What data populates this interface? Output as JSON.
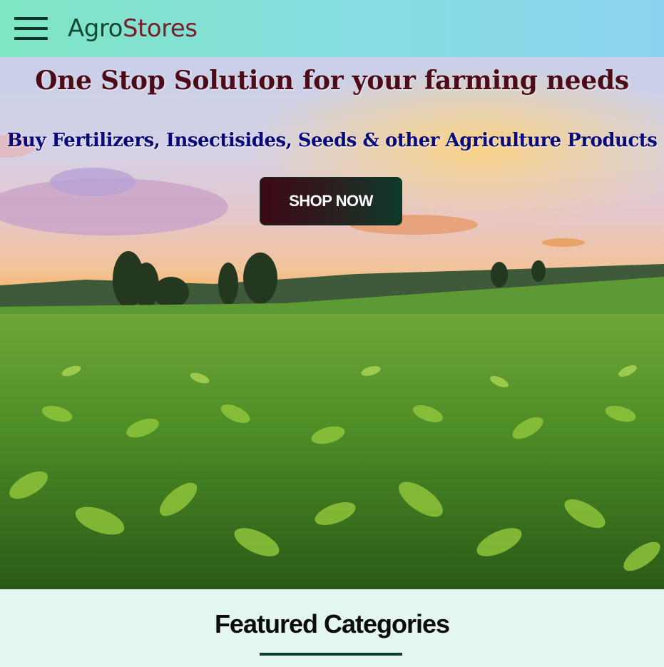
{
  "navbar": {
    "menu_icon": "hamburger-menu-icon",
    "brand_part1": "Agro",
    "brand_part2": "Stores"
  },
  "hero": {
    "title": "One Stop Solution for your farming needs",
    "subtitle": "Buy Fertilizers, Insectisides, Seeds & other Agriculture Products",
    "cta_label": "SHOP NOW",
    "image": "tea-plantation-sunset-photo"
  },
  "featured": {
    "heading": "Featured Categories"
  },
  "colors": {
    "brand_green": "#0f4a33",
    "brand_maroon": "#7a1f2a",
    "hero_title": "#4d0b19",
    "hero_subtitle": "#09097e",
    "section_bg": "#e3f7f0"
  }
}
